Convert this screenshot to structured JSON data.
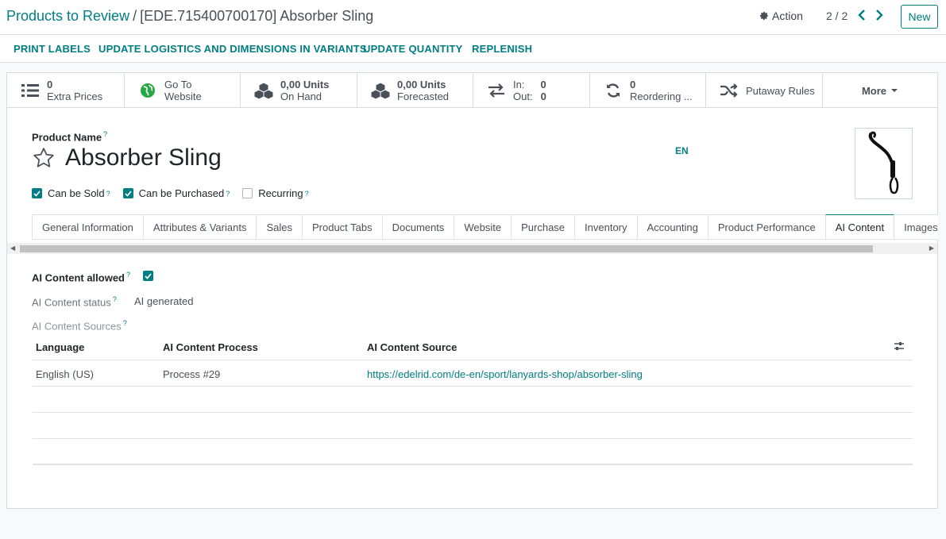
{
  "breadcrumb": {
    "parent": "Products to Review",
    "separator": "/",
    "current": "[EDE.715400700170] Absorber Sling"
  },
  "control": {
    "action_label": "Action",
    "pager": "2 / 2",
    "new_label": "New"
  },
  "header_buttons": [
    "PRINT LABELS",
    "UPDATE LOGISTICS AND DIMENSIONS IN VARIANTS",
    "UPDATE QUANTITY",
    "REPLENISH"
  ],
  "stat_buttons": {
    "extra_prices": {
      "value": "0",
      "label": "Extra Prices"
    },
    "website": {
      "line1": "Go To",
      "line2": "Website"
    },
    "on_hand": {
      "value": "0,00 Units",
      "label": "On Hand"
    },
    "forecasted": {
      "value": "0,00 Units",
      "label": "Forecasted"
    },
    "in_out": {
      "in_label": "In:",
      "in_value": "0",
      "out_label": "Out:",
      "out_value": "0"
    },
    "reordering": {
      "value": "0",
      "label": "Reordering ..."
    },
    "putaway": {
      "label": "Putaway Rules"
    },
    "more": {
      "label": "More"
    }
  },
  "product": {
    "name_label": "Product Name",
    "help_mark": "?",
    "name": "Absorber Sling",
    "lang": "EN"
  },
  "checkboxes": {
    "sold": {
      "label": "Can be Sold",
      "checked": true
    },
    "purchased": {
      "label": "Can be Purchased",
      "checked": true
    },
    "recurring": {
      "label": "Recurring",
      "checked": false
    }
  },
  "tabs": [
    "General Information",
    "Attributes & Variants",
    "Sales",
    "Product Tabs",
    "Documents",
    "Website",
    "Purchase",
    "Inventory",
    "Accounting",
    "Product Performance",
    "AI Content",
    "Images"
  ],
  "active_tab": "AI Content",
  "ai": {
    "allowed_label": "AI Content allowed",
    "allowed": true,
    "status_label": "AI Content status",
    "status_value": "AI generated",
    "sources_label": "AI Content Sources"
  },
  "table": {
    "headers": [
      "Language",
      "AI Content Process",
      "AI Content Source"
    ],
    "rows": [
      [
        "English (US)",
        "Process #29",
        "https://edelrid.com/de-en/sport/lanyards-shop/absorber-sling"
      ]
    ]
  },
  "colors": {
    "accent": "#017e84",
    "text": "#212529",
    "muted": "#6c757d",
    "border": "#dee2e6"
  }
}
